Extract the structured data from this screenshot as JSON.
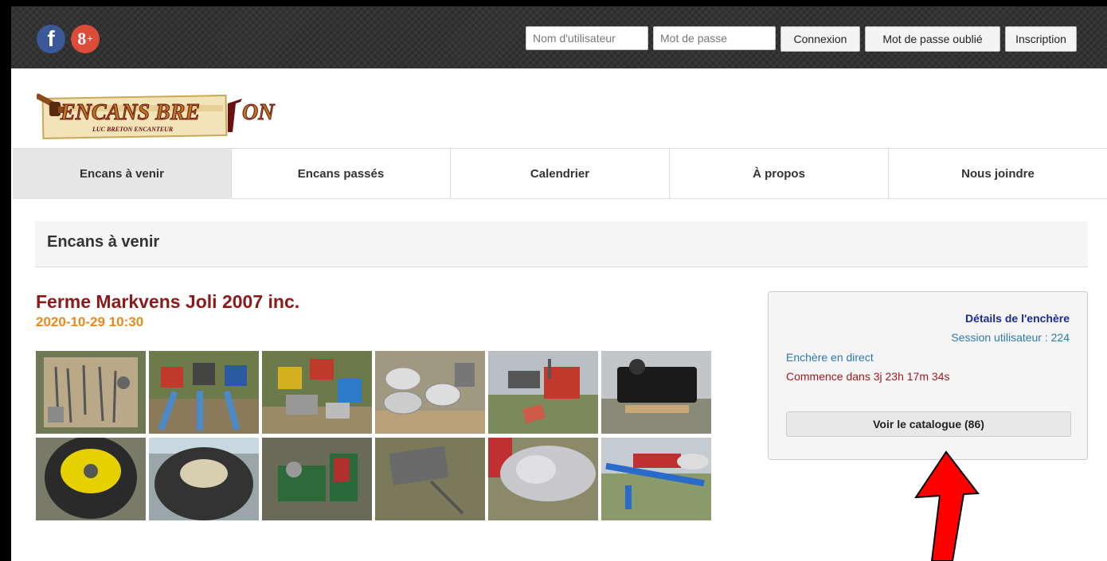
{
  "social": {
    "facebook_icon_label": "f",
    "googleplus_icon_label": "8",
    "googleplus_icon_sup": "+"
  },
  "login": {
    "username_placeholder": "Nom d'utilisateur",
    "password_placeholder": "Mot de passe",
    "login_button": "Connexion",
    "forgot_button": "Mot de passe oublié",
    "register_button": "Inscription"
  },
  "logo": {
    "main_text_1": "ENCANS BRE",
    "main_text_2": "ON",
    "sub_text": "LUC BRETON ENCANTEUR",
    "primary_color": "#b87a1a",
    "secondary_color": "#6a1010"
  },
  "nav": {
    "items": [
      {
        "label": "Encans à venir",
        "active": true
      },
      {
        "label": "Encans passés",
        "active": false
      },
      {
        "label": "Calendrier",
        "active": false
      },
      {
        "label": "À propos",
        "active": false
      },
      {
        "label": "Nous joindre",
        "active": false
      }
    ]
  },
  "section": {
    "title": "Encans à venir"
  },
  "auction": {
    "title": "Ferme Markvens Joli 2007 inc.",
    "date": "2020-10-29 10:30",
    "thumbnail_count": 12
  },
  "details": {
    "title": "Détails de l'enchère",
    "session": "Session utilisateur : 224",
    "live": "Enchère en direct",
    "countdown": "Commence dans 3j 23h 17m 34s",
    "catalogue_button": "Voir le catalogue (86)"
  },
  "colors": {
    "topbar": "#333333",
    "title_red": "#8b1a1a",
    "date_orange": "#e8891e",
    "link_blue": "#2a7ab0",
    "arrow_red": "#ff0000"
  }
}
